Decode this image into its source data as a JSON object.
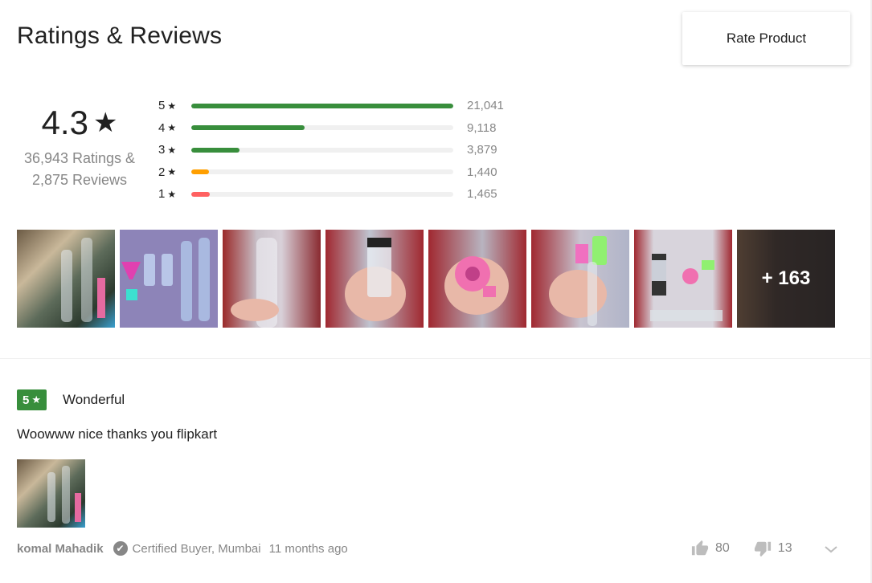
{
  "header": {
    "title": "Ratings & Reviews",
    "rate_button": "Rate Product"
  },
  "summary": {
    "average": "4.3",
    "ratings_line": "36,943 Ratings &",
    "reviews_line": "2,875 Reviews"
  },
  "distribution": [
    {
      "stars": "5",
      "count": "21,041",
      "fraction": 1.0,
      "color": "#388e3c"
    },
    {
      "stars": "4",
      "count": "9,118",
      "fraction": 0.433,
      "color": "#388e3c"
    },
    {
      "stars": "3",
      "count": "3,879",
      "fraction": 0.184,
      "color": "#388e3c"
    },
    {
      "stars": "2",
      "count": "1,440",
      "fraction": 0.068,
      "color": "#ff9f00"
    },
    {
      "stars": "1",
      "count": "1,465",
      "fraction": 0.07,
      "color": "#ff6161"
    }
  ],
  "gallery": {
    "more_label": "+ 163"
  },
  "review": {
    "rating": "5",
    "title": "Wonderful",
    "text": "Woowww nice thanks you flipkart",
    "reviewer": "komal Mahadik",
    "buyer_info": "Certified Buyer, Mumbai",
    "time": "11 months ago",
    "likes": "80",
    "dislikes": "13"
  },
  "colors": {
    "green": "#388e3c",
    "orange": "#ff9f00",
    "red": "#ff6161",
    "grey_text": "#878787"
  }
}
